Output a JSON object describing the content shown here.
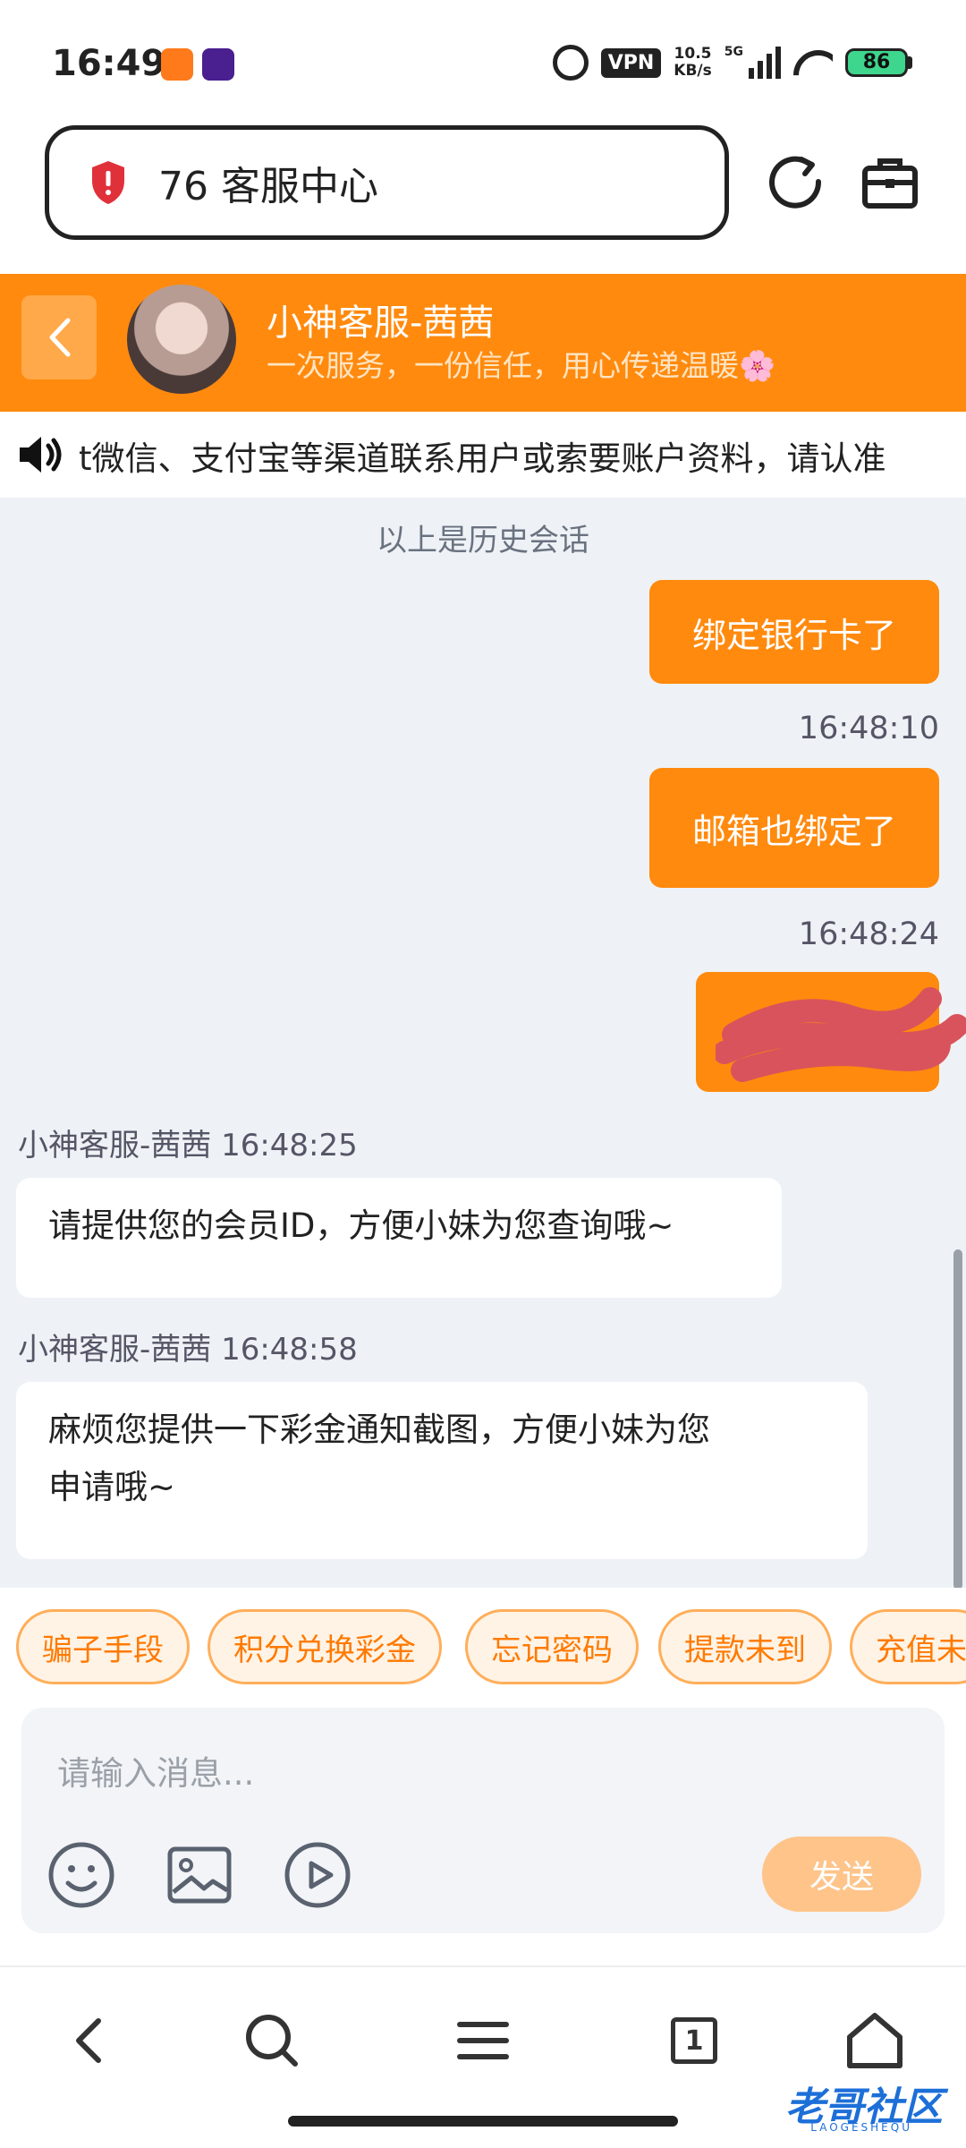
{
  "status_bar": {
    "time": "16:49",
    "vpn": "VPN",
    "speed_value": "10.5",
    "speed_unit": "KB/s",
    "network": "5G",
    "battery": "86"
  },
  "browser": {
    "url_title": "76 客服中心",
    "icons": [
      "shield-icon",
      "refresh-icon",
      "bag-icon"
    ]
  },
  "chat_header": {
    "agent_name": "小神客服-茜茜",
    "slogan": "一次服务，一份信任，用心传递温暖🌸"
  },
  "notice": {
    "text": "t微信、支付宝等渠道联系用户或索要账户资料，请认准"
  },
  "chat": {
    "history_divider": "以上是历史会话",
    "messages": [
      {
        "direction": "out",
        "text": "绑定银行卡了"
      },
      {
        "direction": "out",
        "time": "16:48:10",
        "text": "邮箱也绑定了"
      },
      {
        "direction": "out",
        "time": "16:48:24",
        "text": "",
        "redacted": true
      },
      {
        "direction": "in",
        "sender": "小神客服-茜茜 16:48:25",
        "text": "请提供您的会员ID，方便小妹为您查询哦~"
      },
      {
        "direction": "in",
        "sender": "小神客服-茜茜 16:48:58",
        "text_line1": "麻烦您提供一下彩金通知截图，方便小妹为您",
        "text_line2": "申请哦~"
      }
    ]
  },
  "quick_chips": [
    "骗子手段",
    "积分兑换彩金",
    "忘记密码",
    "提款未到",
    "充值未"
  ],
  "composer": {
    "placeholder": "请输入消息...",
    "send_label": "发送"
  },
  "bottom_nav": {
    "tab_count": "1"
  },
  "watermark": {
    "text": "老哥社区",
    "sub": "LAOGESHEQU"
  },
  "colors": {
    "accent": "#ff8a0e",
    "chat_bg": "#eef2f6",
    "redaction": "#d9535c"
  }
}
